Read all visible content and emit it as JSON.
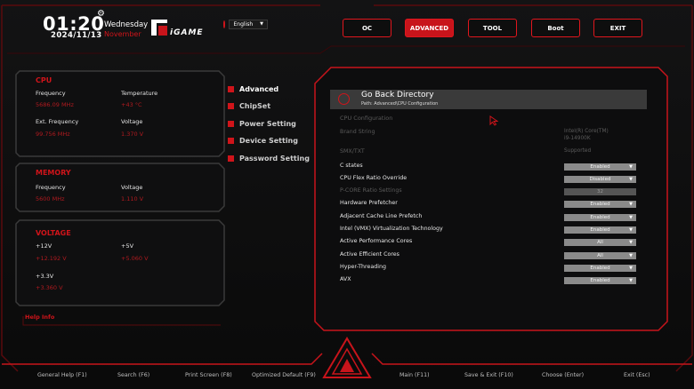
{
  "header": {
    "time": "01:20",
    "day": "Wednesday",
    "month": "November",
    "date": "2024/11/13",
    "brand": "iGAME",
    "language": "English"
  },
  "tabs": [
    {
      "label": "OC",
      "active": false
    },
    {
      "label": "ADVANCED",
      "active": true
    },
    {
      "label": "TOOL",
      "active": false
    },
    {
      "label": "Boot",
      "active": false
    },
    {
      "label": "EXIT",
      "active": false
    }
  ],
  "cpu": {
    "title": "CPU",
    "frequency_label": "Frequency",
    "frequency_value": "5686.09 MHz",
    "temperature_label": "Temperature",
    "temperature_value": "+43 °C",
    "ext_frequency_label": "Ext. Frequency",
    "ext_frequency_value": "99.756 MHz",
    "voltage_label": "Voltage",
    "voltage_value": "1.370 V"
  },
  "memory": {
    "title": "MEMORY",
    "frequency_label": "Frequency",
    "frequency_value": "5600 MHz",
    "voltage_label": "Voltage",
    "voltage_value": "1.110 V"
  },
  "voltage": {
    "title": "VOLTAGE",
    "v12_label": "+12V",
    "v12_value": "+12.192 V",
    "v5_label": "+5V",
    "v5_value": "+5.060 V",
    "v33_label": "+3.3V",
    "v33_value": "+3.360 V"
  },
  "help_info": "Help Info",
  "menu": [
    {
      "label": "Advanced",
      "active": true
    },
    {
      "label": "ChipSet",
      "active": false
    },
    {
      "label": "Power Setting",
      "active": false
    },
    {
      "label": "Device Setting",
      "active": false
    },
    {
      "label": "Password Setting",
      "active": false
    }
  ],
  "config": {
    "go_back": "Go Back Directory",
    "path": "Path: Advanced\\CPU Configuration",
    "section": "CPU Configuration",
    "brand_string_label": "Brand String",
    "brand_string_value1": "Intel(R) Core(TM)",
    "brand_string_value2": "i9-14900K",
    "smx_label": "SMX/TXT",
    "smx_value": "Supported",
    "rows": [
      {
        "label": "C states",
        "value": "Enabled",
        "dropdown": true,
        "disabled": false
      },
      {
        "label": "CPU Flex Ratio Override",
        "value": "Disabled",
        "dropdown": true,
        "disabled": false
      },
      {
        "label": "P-CORE Ratio Settings",
        "value": "32",
        "dropdown": false,
        "disabled": true
      },
      {
        "label": "Hardware Prefetcher",
        "value": "Enabled",
        "dropdown": true,
        "disabled": false
      },
      {
        "label": "Adjacent Cache Line Prefetch",
        "value": "Enabled",
        "dropdown": true,
        "disabled": false
      },
      {
        "label": "Intel (VMX) Virtualization Technology",
        "value": "Enabled",
        "dropdown": true,
        "disabled": false
      },
      {
        "label": "Active Performance Cores",
        "value": "All",
        "dropdown": true,
        "disabled": false
      },
      {
        "label": "Active Efficient Cores",
        "value": "All",
        "dropdown": true,
        "disabled": false
      },
      {
        "label": "Hyper-Threading",
        "value": "Enabled",
        "dropdown": true,
        "disabled": false
      },
      {
        "label": "AVX",
        "value": "Enabled",
        "dropdown": true,
        "disabled": false
      }
    ]
  },
  "bottom": {
    "general_help": "General Help (F1)",
    "search": "Search (F6)",
    "print_screen": "Print Screen (F8)",
    "optimized_default": "Optimized Default (F9)",
    "main": "Main (F11)",
    "save_exit": "Save & Exit (F10)",
    "choose": "Choose (Enter)",
    "exit": "Exit (Esc)"
  },
  "colors": {
    "accent": "#d0141a",
    "background": "#0c0c0d",
    "option_box": "#8a8a8a"
  }
}
